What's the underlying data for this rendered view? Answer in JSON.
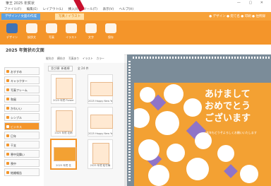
{
  "window": {
    "title": "筆王 2025 年賀状",
    "controls": "— ▢ ✕"
  },
  "menu": [
    "ファイル(F)",
    "編集(E)",
    "レイアウト(L)",
    "挿入(I)",
    "ツール(T)",
    "表示(V)",
    "ヘルプ(H)"
  ],
  "ribbon": {
    "tabs": [
      "デザイン / 文面の作成",
      "写真 / イラスト"
    ],
    "status": "● デザイン ● 宛て名 ● 印刷 ● 住所録"
  },
  "toolbar": {
    "buttons": [
      "デザイン",
      "挨拶文",
      "写真",
      "イラスト",
      "文字",
      "保存"
    ]
  },
  "subbar": {
    "title": "2025 年賀状の文面"
  },
  "sidebar": {
    "items": [
      "おすすめ",
      "キャラクター",
      "写真フレーム",
      "和風",
      "かわいい",
      "シンプル",
      "ビジネス",
      "巳年",
      "干支",
      "寒中見舞い",
      "喪中",
      "結婚報告"
    ],
    "selected_index": 6
  },
  "filters": [
    "縦向き",
    "横向き",
    "写真あり",
    "イラスト",
    "カラー"
  ],
  "gallery": {
    "sort_label": "並び順: 新着順",
    "count": "全 24 件",
    "cards": [
      "2025 年賀 Flower",
      "2025 Happy New Year",
      "2025 年賀 花柄",
      "2025 Happy New Year",
      "2025 年賀 花",
      "2025 年賀 松竹梅"
    ]
  },
  "canvas": {
    "line1": "あけまして",
    "line2": "おめでとう",
    "line3": "ございます",
    "subtext": "本年もどうぞよろしくお願いいたします"
  }
}
